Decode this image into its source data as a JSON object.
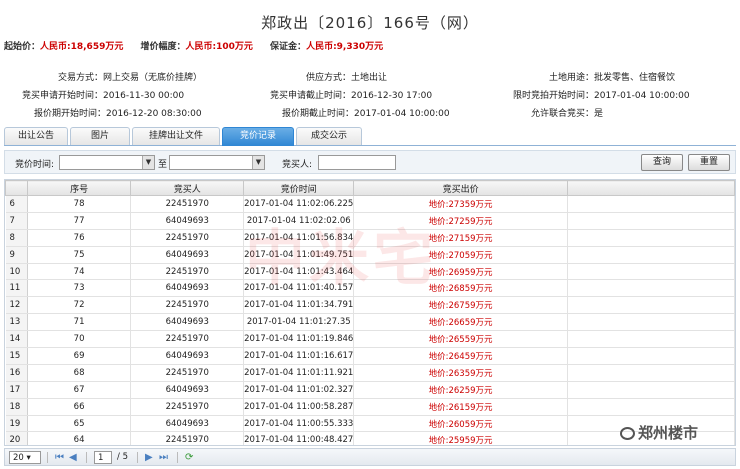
{
  "title": "郑政出〔2016〕166号（网）",
  "prices": {
    "start_label": "起始价：",
    "start_value": "人民币:18,659万元",
    "increment_label": "增价幅度：",
    "increment_value": "人民币:100万元",
    "deposit_label": "保证金：",
    "deposit_value": "人民币:9,330万元"
  },
  "info": {
    "trade_method": "交易方式：网上交易（无底价挂牌）",
    "supply_method": "供应方式：土地出让",
    "land_use": "土地用途：批发零售、住宿餐饮",
    "apply_start": "竞买申请开始时间：2016-11-30 00:00",
    "apply_end": "竞买申请截止时间：2016-12-30 17:00",
    "limit_start": "限时竞拍开始时间：2017-01-04 10:00:00",
    "quote_start": "报价期开始时间：2016-12-20 08:30:00",
    "quote_end": "报价期截止时间：2017-01-04 10:00:00",
    "joint_bid": "允许联合竞买：是"
  },
  "tabs": [
    "出让公告",
    "图片",
    "挂牌出让文件",
    "竞价记录",
    "成交公示"
  ],
  "filter": {
    "time_label": "竞价时间:",
    "to_label": "至",
    "buyer_label": "竞买人:",
    "query_button": "查询",
    "reset_button": "重置"
  },
  "table": {
    "headers": [
      "序号",
      "竞买人",
      "竞价时间",
      "竞买出价"
    ],
    "rows": [
      {
        "rn": "6",
        "seq": "78",
        "buyer": "22451970",
        "time": "2017-01-04 11:02:06.225",
        "bid": "地价:27359万元"
      },
      {
        "rn": "7",
        "seq": "77",
        "buyer": "64049693",
        "time": "2017-01-04 11:02:02.06",
        "bid": "地价:27259万元"
      },
      {
        "rn": "8",
        "seq": "76",
        "buyer": "22451970",
        "time": "2017-01-04 11:01:56.834",
        "bid": "地价:27159万元"
      },
      {
        "rn": "9",
        "seq": "75",
        "buyer": "64049693",
        "time": "2017-01-04 11:01:49.751",
        "bid": "地价:27059万元"
      },
      {
        "rn": "10",
        "seq": "74",
        "buyer": "22451970",
        "time": "2017-01-04 11:01:43.464",
        "bid": "地价:26959万元"
      },
      {
        "rn": "11",
        "seq": "73",
        "buyer": "64049693",
        "time": "2017-01-04 11:01:40.157",
        "bid": "地价:26859万元"
      },
      {
        "rn": "12",
        "seq": "72",
        "buyer": "22451970",
        "time": "2017-01-04 11:01:34.791",
        "bid": "地价:26759万元"
      },
      {
        "rn": "13",
        "seq": "71",
        "buyer": "64049693",
        "time": "2017-01-04 11:01:27.35",
        "bid": "地价:26659万元"
      },
      {
        "rn": "14",
        "seq": "70",
        "buyer": "22451970",
        "time": "2017-01-04 11:01:19.846",
        "bid": "地价:26559万元"
      },
      {
        "rn": "15",
        "seq": "69",
        "buyer": "64049693",
        "time": "2017-01-04 11:01:16.617",
        "bid": "地价:26459万元"
      },
      {
        "rn": "16",
        "seq": "68",
        "buyer": "22451970",
        "time": "2017-01-04 11:01:11.921",
        "bid": "地价:26359万元"
      },
      {
        "rn": "17",
        "seq": "67",
        "buyer": "64049693",
        "time": "2017-01-04 11:01:02.327",
        "bid": "地价:26259万元"
      },
      {
        "rn": "18",
        "seq": "66",
        "buyer": "22451970",
        "time": "2017-01-04 11:00:58.287",
        "bid": "地价:26159万元"
      },
      {
        "rn": "19",
        "seq": "65",
        "buyer": "64049693",
        "time": "2017-01-04 11:00:55.333",
        "bid": "地价:26059万元"
      },
      {
        "rn": "20",
        "seq": "64",
        "buyer": "22451970",
        "time": "2017-01-04 11:00:48.427",
        "bid": "地价:25959万元"
      }
    ]
  },
  "pager": {
    "page_size": "20",
    "current_page": "1",
    "total": "/ 5"
  },
  "watermark": {
    "brand": "郑州楼市",
    "bg_text": "中米宅"
  },
  "colors": {
    "accent": "#2f86d4",
    "price_red": "#cc0000"
  }
}
